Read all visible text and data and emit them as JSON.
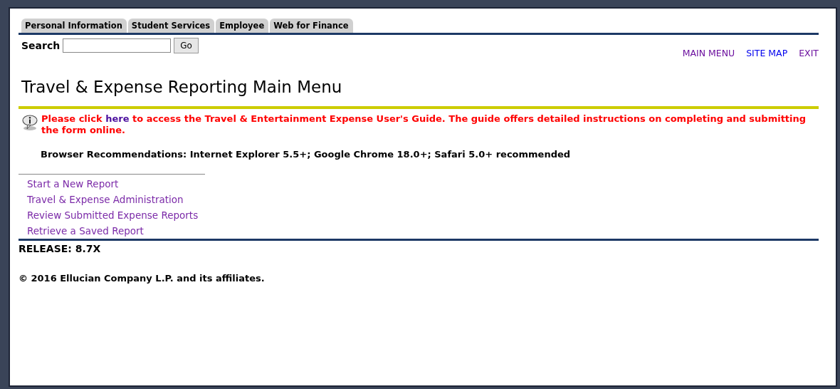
{
  "tabs": [
    {
      "label": "Personal Information",
      "selected": false
    },
    {
      "label": "Student Services",
      "selected": false
    },
    {
      "label": "Employee",
      "selected": false
    },
    {
      "label": "Web for Finance",
      "selected": false
    }
  ],
  "search": {
    "label": "Search",
    "button": "Go"
  },
  "top_links": [
    {
      "label": "MAIN MENU",
      "visited": true
    },
    {
      "label": "SITE MAP",
      "visited": false
    },
    {
      "label": "EXIT",
      "visited": true
    }
  ],
  "page_title": "Travel & Expense Reporting Main Menu",
  "notice": {
    "before": "Please click",
    "link": "here",
    "after": "to access the Travel & Entertainment Expense User's Guide. The guide offers detailed instructions on completing and submitting the form online."
  },
  "recommendation": "Browser Recommendations: Internet Explorer 5.5+; Google Chrome 18.0+; Safari 5.0+ recommended",
  "menu_links": [
    {
      "label": "Start a New Report",
      "visited": true
    },
    {
      "label": "Travel & Expense Administration",
      "visited": true
    },
    {
      "label": "Review Submitted Expense Reports",
      "visited": true
    },
    {
      "label": "Retrieve a Saved Report",
      "visited": true
    }
  ],
  "release": "RELEASE: 8.7X",
  "copyright": "© 2016 Ellucian Company L.P. and its affiliates."
}
